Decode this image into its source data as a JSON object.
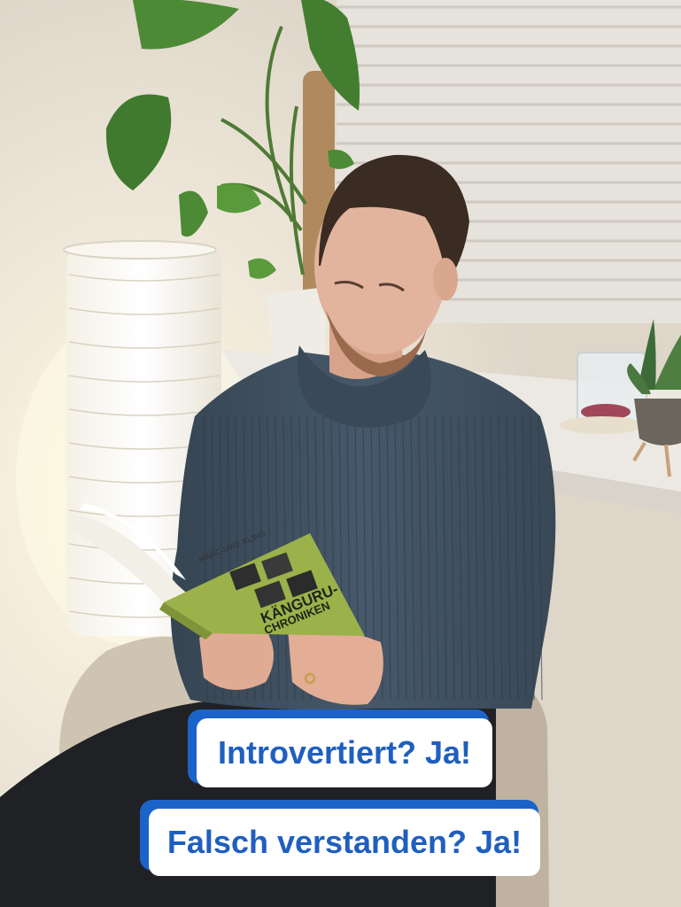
{
  "scene": {
    "subject": "man-reading-book",
    "colors": {
      "wall": "#e7e3dc",
      "sweater": "#3f4f5e",
      "leaf": "#3f7a2e",
      "book_cover": "#9bb14a",
      "caption_text": "#1f5fbf",
      "caption_border": "#1c63c9"
    }
  },
  "book": {
    "author": "MARC-UWE KLING",
    "title_line1": "KÄNGURU-",
    "title_line2": "CHRONIKEN"
  },
  "captions": [
    {
      "text": "Introvertiert? Ja!"
    },
    {
      "text": "Falsch verstanden? Ja!"
    }
  ]
}
